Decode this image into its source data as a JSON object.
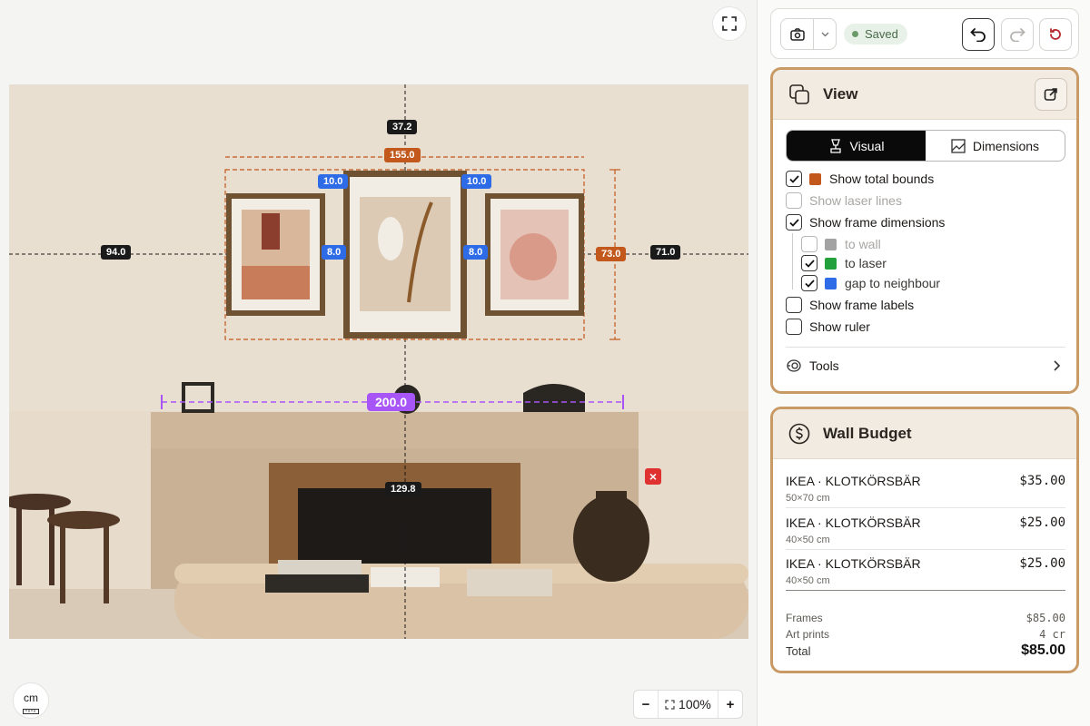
{
  "canvas": {
    "dims": {
      "top": "37.2",
      "total_width": "155.0",
      "gap_left": "10.0",
      "gap_right": "10.0",
      "to_wall_left": "94.0",
      "side_gap_left": "8.0",
      "side_gap_right": "8.0",
      "height": "73.0",
      "to_wall_right": "71.0",
      "ruler": "200.0",
      "to_floor": "129.8"
    },
    "delete_icon": "close-icon",
    "unit": "cm",
    "zoom": {
      "minus": "−",
      "value": "100%",
      "plus": "+"
    }
  },
  "toolbar": {
    "saved": "Saved"
  },
  "view": {
    "title": "View",
    "tabs": [
      "Visual",
      "Dimensions"
    ],
    "options": [
      {
        "label": "Show total bounds",
        "checked": true,
        "swatch": "#c2581b"
      },
      {
        "label": "Show laser lines",
        "checked": false
      },
      {
        "label": "Show frame dimensions",
        "checked": true
      },
      {
        "label": "to wall",
        "checked": false,
        "swatch": "#a3a3a3"
      },
      {
        "label": "to laser",
        "checked": true,
        "swatch": "#22a03c"
      },
      {
        "label": "gap to neighbour",
        "checked": true,
        "swatch": "#2e6be6"
      },
      {
        "label": "Show frame labels",
        "checked": false
      },
      {
        "label": "Show ruler",
        "checked": false
      }
    ],
    "tools": "Tools"
  },
  "budget": {
    "title": "Wall Budget",
    "items": [
      {
        "name": "IKEA · KLOTKÖRSBÄR",
        "size": "50×70 cm",
        "price": "$35.00"
      },
      {
        "name": "IKEA · KLOTKÖRSBÄR",
        "size": "40×50 cm",
        "price": "$25.00"
      },
      {
        "name": "IKEA · KLOTKÖRSBÄR",
        "size": "40×50 cm",
        "price": "$25.00"
      }
    ],
    "frames_label": "Frames",
    "frames_value": "$85.00",
    "art_label": "Art prints",
    "art_value": "4 cr",
    "total_label": "Total",
    "total_value": "$85.00"
  }
}
